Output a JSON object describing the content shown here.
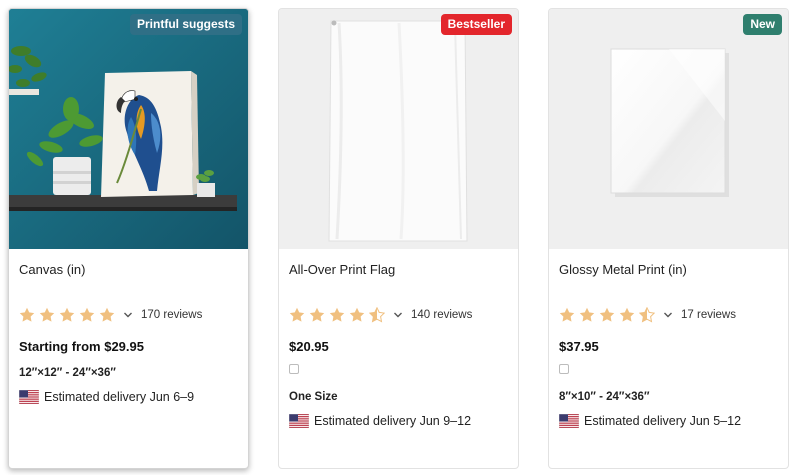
{
  "colors": {
    "star": "#f0c080",
    "star_empty": "#dedede",
    "badge_printful": "#2f6f86",
    "badge_bestseller": "#e3262c",
    "badge_new": "#2f7f6e"
  },
  "products": [
    {
      "badge": "Printful suggests",
      "image_icon": "canvas-photo-parrot",
      "title": "Canvas (in)",
      "rating": 5,
      "reviews": "170 reviews",
      "price": "Starting from $29.95",
      "size": "12″×12″ - 24″×36″",
      "delivery": "Estimated delivery Jun 6–9"
    },
    {
      "badge": "Bestseller",
      "image_icon": "white-flag",
      "title": "All-Over Print Flag",
      "rating": 4.5,
      "reviews": "140 reviews",
      "price": "$20.95",
      "size": "One Size",
      "delivery": "Estimated delivery Jun 9–12"
    },
    {
      "badge": "New",
      "image_icon": "metal-print-panel",
      "title": "Glossy Metal Print (in)",
      "rating": 4.5,
      "reviews": "17 reviews",
      "price": "$37.95",
      "size": "8″×10″ - 24″×36″",
      "delivery": "Estimated delivery Jun 5–12"
    }
  ]
}
